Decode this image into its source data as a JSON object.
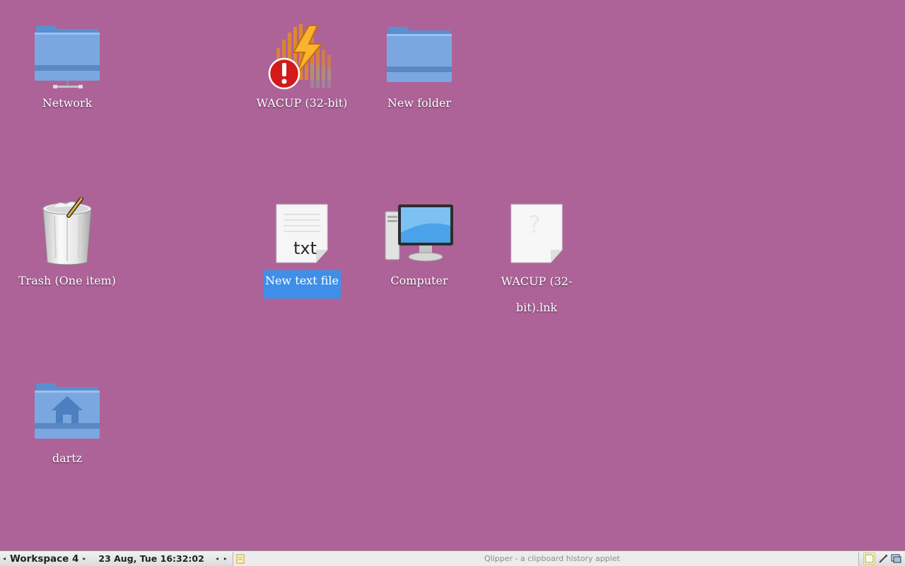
{
  "desktop": {
    "background_color": "#ad6398",
    "icons": [
      {
        "label": "Network",
        "icon": "network-folder-icon"
      },
      {
        "label": "WACUP (32-bit)",
        "icon": "wacup-app-icon"
      },
      {
        "label": "New folder",
        "icon": "folder-icon"
      },
      {
        "label": "Trash (One item)",
        "icon": "trash-full-icon"
      },
      {
        "label": "New text file",
        "icon": "text-file-icon",
        "selected": true
      },
      {
        "label": "Computer",
        "icon": "computer-icon"
      },
      {
        "label": "WACUP (32-bit).lnk",
        "icon": "unknown-file-icon"
      },
      {
        "label": "dartz",
        "icon": "home-folder-icon"
      }
    ],
    "selection_color": "#3f8fe8"
  },
  "taskbar": {
    "prev_workspace": "◂",
    "workspace": "Workspace 4",
    "next_workspace": "▸",
    "clock": "23 Aug, Tue 16:32:02",
    "prev_task": "◂",
    "next_task": "▸",
    "clipboard_tooltip": "Qlipper - a clipboard history applet",
    "tray_icons": [
      "notes-icon",
      "pen-icon",
      "desktop-icon"
    ]
  }
}
